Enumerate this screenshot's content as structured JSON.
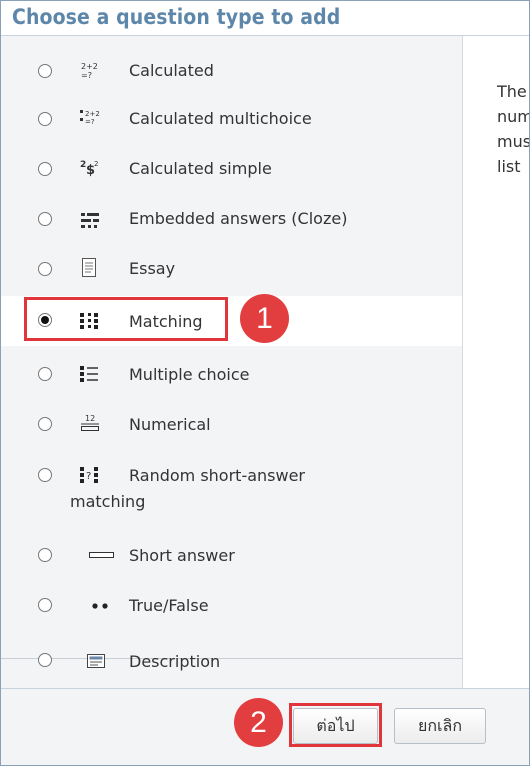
{
  "dialog": {
    "title": "Choose a question type to add"
  },
  "options": [
    {
      "label": "Calculated",
      "icon": "calculated-icon",
      "checked": false
    },
    {
      "label": "Calculated multichoice",
      "icon": "calculated-multichoice-icon",
      "checked": false
    },
    {
      "label": "Calculated simple",
      "icon": "calculated-simple-icon",
      "checked": false
    },
    {
      "label": "Embedded answers (Cloze)",
      "icon": "cloze-icon",
      "checked": false
    },
    {
      "label": "Essay",
      "icon": "essay-icon",
      "checked": false
    },
    {
      "label": "Matching",
      "icon": "matching-icon",
      "checked": true
    },
    {
      "label": "Multiple choice",
      "icon": "multiple-choice-icon",
      "checked": false
    },
    {
      "label": "Numerical",
      "icon": "numerical-icon",
      "checked": false
    },
    {
      "label": "Random short-answer",
      "label2": "matching",
      "icon": "random-short-answer-matching-icon",
      "checked": false
    },
    {
      "label": "Short answer",
      "icon": "short-answer-icon",
      "checked": false
    },
    {
      "label": "True/False",
      "icon": "true-false-icon",
      "checked": false
    },
    {
      "label": "Description",
      "icon": "description-icon",
      "checked": false
    }
  ],
  "description": {
    "lines": [
      "The",
      "num",
      "mus",
      "list"
    ]
  },
  "footer": {
    "next_label": "ต่อไป",
    "cancel_label": "ยกเลิก"
  },
  "annotations": {
    "badge1": "1",
    "badge2": "2",
    "color": "#e0363b"
  }
}
